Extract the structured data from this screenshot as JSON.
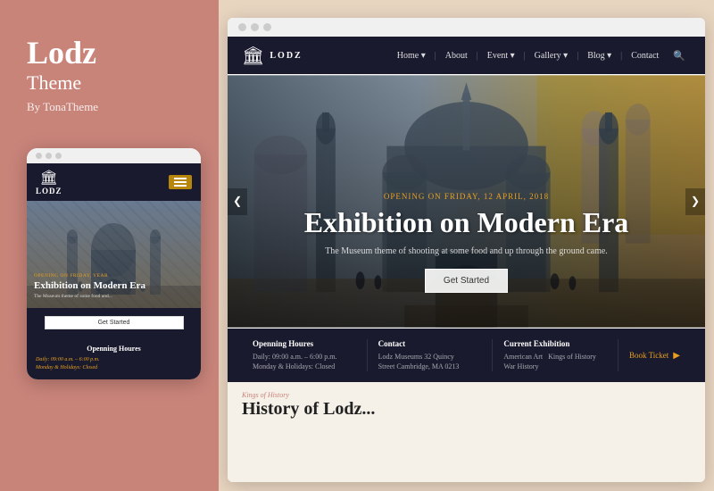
{
  "left": {
    "brand_title": "Lodz",
    "brand_subtitle": "Theme",
    "brand_by": "By TonaTheme",
    "mobile_dots": [
      "dot1",
      "dot2",
      "dot3"
    ],
    "mobile_logo": "LODZ",
    "mobile_opening_label": "OPENING ON FRIDAY, ",
    "mobile_opening_date": "YEAR",
    "mobile_hero_title": "Exhibition on Modern Era",
    "mobile_hero_subtitle": "The Museum theme of some food and...",
    "mobile_get_started": "Get Started",
    "mobile_info_title": "Openning Houres",
    "mobile_info_line1": "Daily: 09:00 a.m. – 6:00 p.m.",
    "mobile_info_line2": "Monday & Holidays: Closed"
  },
  "right": {
    "browser_dots": [
      "dot1",
      "dot2",
      "dot3"
    ],
    "nav": {
      "logo": "LODZ",
      "items": [
        {
          "label": "Home ▾",
          "separator": true
        },
        {
          "label": "About",
          "separator": true
        },
        {
          "label": "Event ▾",
          "separator": true
        },
        {
          "label": "Gallery ▾",
          "separator": true
        },
        {
          "label": "Blog ▾",
          "separator": true
        },
        {
          "label": "Contact",
          "separator": false
        }
      ]
    },
    "hero": {
      "opening_label": "OPENING ON FRIDAY, ",
      "opening_date": "12 APRIL, 2018",
      "title": "Exhibition on Modern Era",
      "description": "The Museum theme of shooting at some food and up through the ground came.",
      "get_started": "Get Started",
      "arrow_left": "❮",
      "arrow_right": "❯"
    },
    "info_bar": {
      "sections": [
        {
          "title": "Openning Houres",
          "lines": [
            "Daily: 09:00 a.m. – 6:00 p.m.",
            "Monday & Holidays: Closed"
          ]
        },
        {
          "title": "Contact",
          "lines": [
            "Lodz Museums 32 Quincy",
            "Street Cambridge, MA 0213"
          ]
        },
        {
          "title": "Current Exhibition",
          "lines": [
            "American Art  Kings of History",
            "War History"
          ]
        }
      ],
      "book_ticket": "Book Ticket"
    },
    "bottom": {
      "label": "Kings of History",
      "title": "History of Lodz..."
    }
  }
}
